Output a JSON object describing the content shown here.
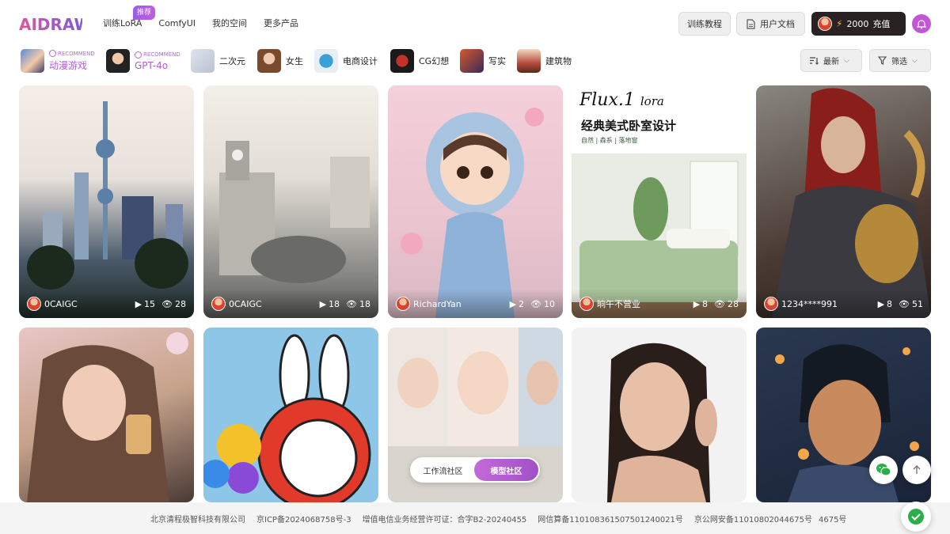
{
  "header": {
    "logo_text": "AIDRAW",
    "nav": [
      {
        "label": "训练LoRA",
        "badge": "推荐"
      },
      {
        "label": "ComfyUI"
      },
      {
        "label": "我的空间"
      },
      {
        "label": "更多产品"
      }
    ],
    "tutorial_label": "训练教程",
    "docs_label": "用户文档",
    "credits_value": "2000",
    "recharge_label": "充值",
    "accent_color": "#c157d6"
  },
  "categories": [
    {
      "label": "动漫游戏",
      "recommend": "RECOMMEND"
    },
    {
      "label": "GPT-4o",
      "recommend": "RECOMMEND"
    },
    {
      "label": "二次元"
    },
    {
      "label": "女生"
    },
    {
      "label": "电商设计"
    },
    {
      "label": "CG幻想"
    },
    {
      "label": "写实"
    },
    {
      "label": "建筑物"
    }
  ],
  "filters": {
    "sort_label": "最新",
    "filter_label": "筛选"
  },
  "cards": [
    {
      "author": "0CAIGC",
      "likes": "15",
      "views": "28"
    },
    {
      "author": "0CAIGC",
      "likes": "18",
      "views": "18"
    },
    {
      "author": "RichardYan",
      "likes": "2",
      "views": "10"
    },
    {
      "author": "晌午不营业",
      "likes": "8",
      "views": "28",
      "title": "Flux.1",
      "title_suffix": "lora",
      "subtitle": "经典美式卧室设计",
      "tags": "自然 | 森系 | 落地窗"
    },
    {
      "author": "1234****991",
      "likes": "8",
      "views": "51"
    }
  ],
  "community": {
    "workflow_label": "工作流社区",
    "model_label": "模型社区"
  },
  "footer": {
    "company": "北京清程极智科技有限公司",
    "icp": "京ICP备2024068758号-3",
    "license": "增值电信业务经营许可证：合字B2-20240455",
    "algo": "网信算备110108361507501240021号",
    "police": "京公网安备110108020446​75号",
    "extra": "4675号"
  }
}
